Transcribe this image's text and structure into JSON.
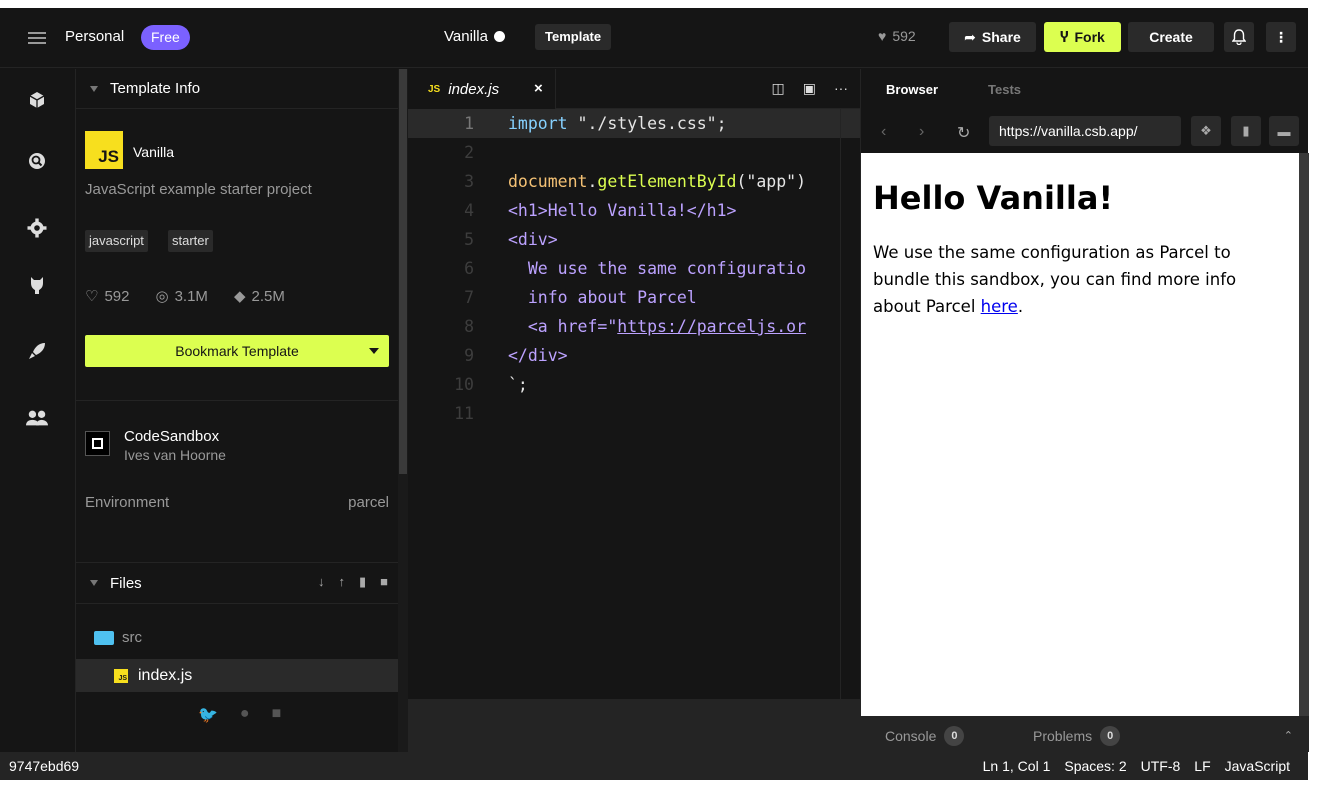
{
  "header": {
    "workspace": "Personal",
    "plan_badge": "Free",
    "sandbox_title": "Vanilla",
    "template_tag": "Template",
    "likes": "592",
    "share_label": "Share",
    "fork_label": "Fork",
    "create_label": "Create"
  },
  "sidebar": {
    "template_info_title": "Template Info",
    "template": {
      "logo_text": "JS",
      "name": "Vanilla",
      "description": "JavaScript example starter project",
      "tags": [
        "javascript",
        "starter"
      ],
      "stats": {
        "likes": "592",
        "views": "3.1M",
        "forks": "2.5M"
      }
    },
    "bookmark_label": "Bookmark Template",
    "team": {
      "name": "CodeSandbox",
      "owner": "Ives van Hoorne"
    },
    "environment": {
      "label": "Environment",
      "value": "parcel"
    },
    "files_title": "Files",
    "files": [
      {
        "type": "folder",
        "name": "src"
      },
      {
        "type": "file",
        "name": "index.js",
        "badge": "JS"
      }
    ]
  },
  "editor": {
    "tab": {
      "badge": "JS",
      "file_name": "index.js",
      "close": "×"
    },
    "lines": [
      {
        "n": "1",
        "segments": [
          {
            "c": "k",
            "t": "import "
          },
          {
            "c": "s",
            "t": "\"./styles.css\";"
          }
        ]
      },
      {
        "n": "2",
        "segments": []
      },
      {
        "n": "3",
        "segments": [
          {
            "c": "o",
            "t": "document"
          },
          {
            "c": "s",
            "t": "."
          },
          {
            "c": "f",
            "t": "getElementById"
          },
          {
            "c": "s",
            "t": "(\"app\")"
          }
        ]
      },
      {
        "n": "4",
        "segments": [
          {
            "c": "p",
            "t": "<h1>Hello Vanilla!</h1>"
          }
        ]
      },
      {
        "n": "5",
        "segments": [
          {
            "c": "p",
            "t": "<div>"
          }
        ]
      },
      {
        "n": "6",
        "segments": [
          {
            "c": "p",
            "t": "  We use the same configuratio"
          }
        ]
      },
      {
        "n": "7",
        "segments": [
          {
            "c": "p",
            "t": "  info about Parcel"
          }
        ]
      },
      {
        "n": "8",
        "segments": [
          {
            "c": "p",
            "t": "  <a href=\""
          },
          {
            "c": "u",
            "t": "https://parceljs.or"
          }
        ]
      },
      {
        "n": "9",
        "segments": [
          {
            "c": "p",
            "t": "</div>"
          }
        ]
      },
      {
        "n": "10",
        "segments": [
          {
            "c": "s",
            "t": "`;"
          }
        ]
      },
      {
        "n": "11",
        "segments": []
      }
    ]
  },
  "preview": {
    "tabs": [
      "Browser",
      "Tests"
    ],
    "url": "https://vanilla.csb.app/",
    "heading": "Hello Vanilla!",
    "paragraph": "We use the same configuration as Parcel to bundle this sandbox, you can find more info about Parcel ",
    "link_text": "here",
    "after_link": ".",
    "console_label": "Console",
    "console_count": "0",
    "problems_label": "Problems",
    "problems_count": "0"
  },
  "statusbar": {
    "commit": "9747ebd69",
    "position": "Ln 1, Col 1",
    "spaces": "Spaces: 2",
    "encoding": "UTF-8",
    "eol": "LF",
    "language": "JavaScript"
  },
  "colors": {
    "accent": "#dcff50",
    "badge": "#7b61ff",
    "js": "#f7df1e"
  }
}
